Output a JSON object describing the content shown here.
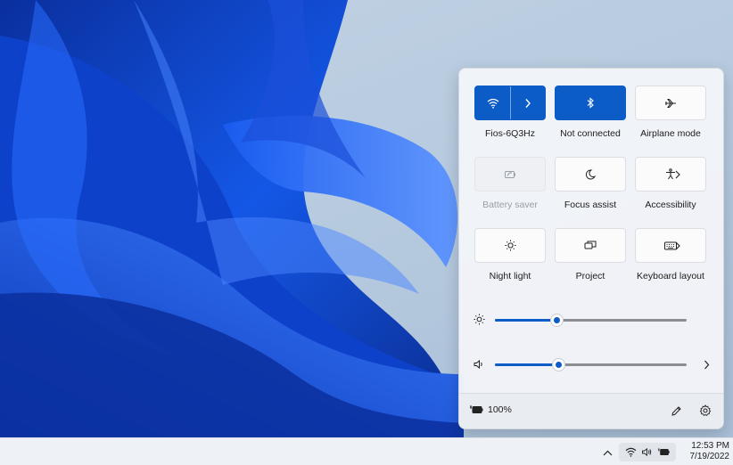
{
  "quick_settings": {
    "tiles": [
      {
        "label": "Fios-6Q3Hz",
        "icon": "wifi-icon",
        "state": "on",
        "has_chevron": true
      },
      {
        "label": "Not connected",
        "icon": "bluetooth-icon",
        "state": "on",
        "has_chevron": false
      },
      {
        "label": "Airplane mode",
        "icon": "airplane-icon",
        "state": "off",
        "has_chevron": false
      },
      {
        "label": "Battery saver",
        "icon": "battery-saver-icon",
        "state": "disabled",
        "has_chevron": false
      },
      {
        "label": "Focus assist",
        "icon": "moon-icon",
        "state": "off",
        "has_chevron": false
      },
      {
        "label": "Accessibility",
        "icon": "accessibility-icon",
        "state": "off",
        "has_chevron": true
      },
      {
        "label": "Night light",
        "icon": "sun-icon",
        "state": "off",
        "has_chevron": false
      },
      {
        "label": "Project",
        "icon": "project-icon",
        "state": "off",
        "has_chevron": false
      },
      {
        "label": "Keyboard layout",
        "icon": "keyboard-icon",
        "state": "off",
        "has_chevron": true
      }
    ],
    "brightness": {
      "icon": "brightness-icon",
      "level_percent": 32
    },
    "volume": {
      "icon": "speaker-icon",
      "level_percent": 33,
      "more_icon": "chevron-right-icon"
    },
    "footer": {
      "battery_icon": "battery-charging-icon",
      "battery_text": "100%",
      "edit_icon": "pencil-icon",
      "settings_icon": "gear-icon"
    }
  },
  "taskbar": {
    "tray_chevron_icon": "chevron-up-icon",
    "tray_icons": [
      "wifi-icon",
      "speaker-icon",
      "battery-charging-icon"
    ],
    "time": "12:53 PM",
    "date": "7/19/2022"
  },
  "colors": {
    "accent": "#0b5cc7",
    "wallpaper_blue": "#0a3fc2"
  }
}
